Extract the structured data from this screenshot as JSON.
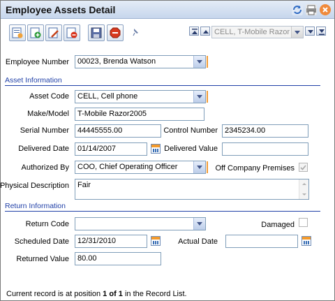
{
  "window": {
    "title": "Employee Assets Detail"
  },
  "toolbar": {
    "record_selector": "CELL, T-Mobile Razor"
  },
  "employee": {
    "label": "Employee Number",
    "value": "00023, Brenda Watson"
  },
  "sections": {
    "asset": "Asset Information",
    "return": "Return Information"
  },
  "asset": {
    "code_label": "Asset Code",
    "code_value": "CELL, Cell phone",
    "make_label": "Make/Model",
    "make_value": "T-Mobile Razor2005",
    "serial_label": "Serial Number",
    "serial_value": "44445555.00",
    "control_label": "Control Number",
    "control_value": "2345234.00",
    "delivered_date_label": "Delivered Date",
    "delivered_date_value": "01/14/2007",
    "delivered_value_label": "Delivered Value",
    "delivered_value_value": "",
    "authorized_label": "Authorized By",
    "authorized_value": "COO, Chief Operating Officer",
    "off_premises_label": "Off Company Premises",
    "off_premises_checked": true,
    "physical_label": "Physical Description",
    "physical_value": "Fair"
  },
  "return": {
    "code_label": "Return Code",
    "code_value": "",
    "damaged_label": "Damaged",
    "damaged_checked": false,
    "scheduled_label": "Scheduled Date",
    "scheduled_value": "12/31/2010",
    "actual_label": "Actual Date",
    "actual_value": "",
    "returned_label": "Returned Value",
    "returned_value": "80.00"
  },
  "status": {
    "prefix": "Current record is at position ",
    "position": "1 of 1",
    "suffix": " in the Record List."
  },
  "colors": {
    "accent": "#1f3fa7",
    "required": "#f29b34"
  }
}
